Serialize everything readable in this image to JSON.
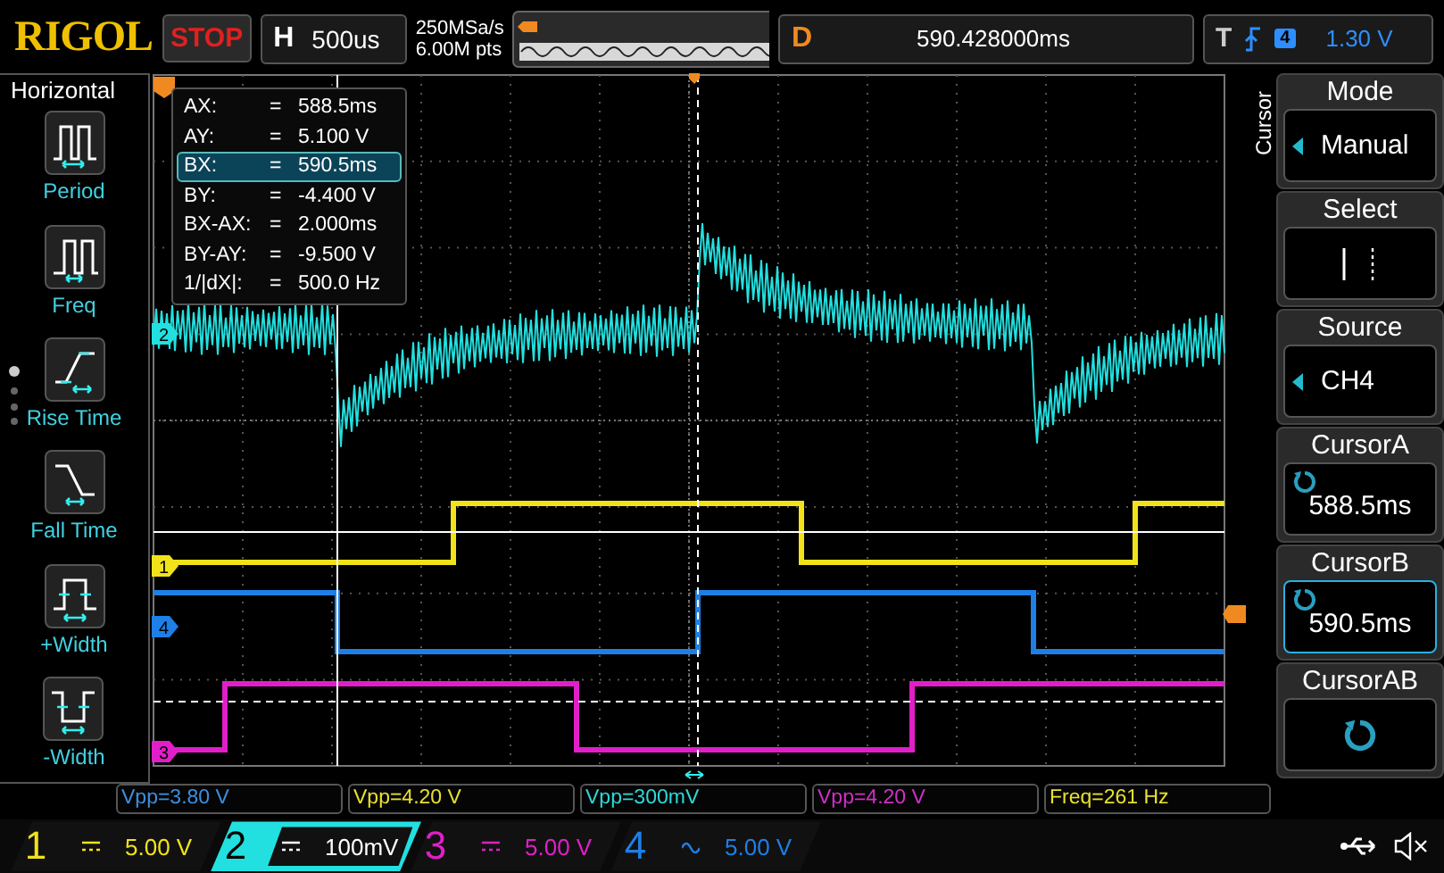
{
  "top_bar": {
    "logo": "RIGOL",
    "run_state": "STOP",
    "horizontal": {
      "label": "H",
      "timebase": "500us"
    },
    "sample_rate": "250MSa/s",
    "memory_depth": "6.00M pts",
    "delay": {
      "label": "D",
      "value": "590.428000ms"
    },
    "trigger": {
      "label": "T",
      "source": "4",
      "level": "1.30 V"
    }
  },
  "left_menu": {
    "title": "Horizontal",
    "items": [
      {
        "label": "Period",
        "kind": "period"
      },
      {
        "label": "Freq",
        "kind": "freq"
      },
      {
        "label": "Rise Time",
        "kind": "rise"
      },
      {
        "label": "Fall Time",
        "kind": "fall"
      },
      {
        "label": "+Width",
        "kind": "pwidth"
      },
      {
        "label": "-Width",
        "kind": "nwidth"
      }
    ]
  },
  "cursor_readout": [
    {
      "name": "AX:",
      "eq": "=",
      "value": "588.5ms",
      "selected": false
    },
    {
      "name": "AY:",
      "eq": "=",
      "value": "5.100 V",
      "selected": false
    },
    {
      "name": "BX:",
      "eq": "=",
      "value": "590.5ms",
      "selected": true
    },
    {
      "name": "BY:",
      "eq": "=",
      "value": "-4.400 V",
      "selected": false
    },
    {
      "name": "BX-AX:",
      "eq": "=",
      "value": "2.000ms",
      "selected": false
    },
    {
      "name": "BY-AY:",
      "eq": "=",
      "value": "-9.500 V",
      "selected": false
    },
    {
      "name": "1/|dX|:",
      "eq": "=",
      "value": "500.0 Hz",
      "selected": false
    }
  ],
  "channel_markers": [
    {
      "label": "2",
      "color": "#22e0e0"
    },
    {
      "label": "1",
      "color": "#f2e21a"
    },
    {
      "label": "4",
      "color": "#1e7fe6"
    },
    {
      "label": "3",
      "color": "#e01fc8"
    }
  ],
  "right_menu": {
    "title": "Cursor",
    "items": [
      {
        "title": "Mode",
        "value": "Manual",
        "kind": "choice",
        "selected": false
      },
      {
        "title": "Select",
        "kind": "select",
        "selected": false
      },
      {
        "title": "Source",
        "value": "CH4",
        "kind": "choice",
        "selected": false
      },
      {
        "title": "CursorA",
        "value": "588.5ms",
        "kind": "knob",
        "selected": false
      },
      {
        "title": "CursorB",
        "value": "590.5ms",
        "kind": "knob",
        "selected": true
      },
      {
        "title": "CursorAB",
        "kind": "knob",
        "selected": false
      }
    ]
  },
  "measurements": [
    {
      "text": "Vpp=3.80 V",
      "color": "#3d8fe0"
    },
    {
      "text": "Vpp=4.20 V",
      "color": "#e8e030"
    },
    {
      "text": "Vpp=300mV",
      "color": "#30d8d8"
    },
    {
      "text": "Vpp=4.20 V",
      "color": "#d030c8"
    },
    {
      "text": "Freq=261 Hz",
      "color": "#e8e030"
    }
  ],
  "channels": [
    {
      "number": "1",
      "kind": "dc",
      "scale": "5.00 V",
      "color": "#f2e21a",
      "selected": false
    },
    {
      "number": "2",
      "kind": "dc",
      "scale": "100mV",
      "color": "#22e0e0",
      "selected": true
    },
    {
      "number": "3",
      "kind": "dc",
      "scale": "5.00 V",
      "color": "#e01fc8",
      "selected": false
    },
    {
      "number": "4",
      "kind": "ac",
      "scale": "5.00 V",
      "color": "#1e7fe6",
      "selected": false
    }
  ]
}
